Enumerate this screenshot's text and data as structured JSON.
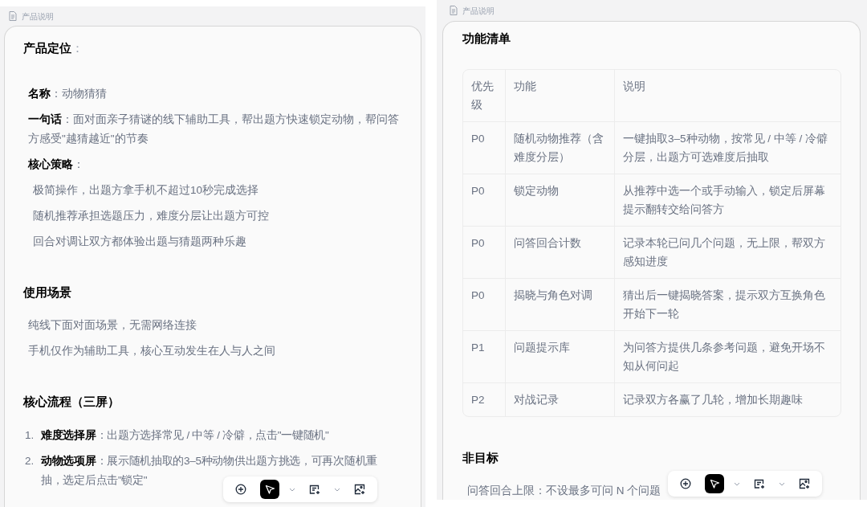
{
  "panels": [
    {
      "header": "产品说明",
      "blocks": [
        {
          "kind": "lead",
          "text": "**产品定位**："
        },
        {
          "kind": "field",
          "text": "**名称**：动物猜猜"
        },
        {
          "kind": "field",
          "text": "**一句话**：面对面亲子猜谜的线下辅助工具，帮出题方快速锁定动物，帮问答方感受\"越猜越近\"的节奏"
        },
        {
          "kind": "field",
          "text": "**核心策略**："
        },
        {
          "kind": "bullet",
          "text": "极简操作，出题方拿手机不超过10秒完成选择"
        },
        {
          "kind": "bullet",
          "text": "随机推荐承担选题压力，难度分层让出题方可控"
        },
        {
          "kind": "bullet",
          "text": "回合对调让双方都体验出题与猜题两种乐趣"
        },
        {
          "kind": "heading",
          "text": "使用场景"
        },
        {
          "kind": "plain",
          "text": "纯线下面对面场景，无需网络连接"
        },
        {
          "kind": "plain",
          "text": "手机仅作为辅助工具，核心互动发生在人与人之间"
        },
        {
          "kind": "heading",
          "text": "核心流程（三屏）"
        },
        {
          "kind": "numbered",
          "number": "1.",
          "text": "**难度选择屏**：出题方选择常见 / 中等 / 冷僻，点击\"一键随机\""
        },
        {
          "kind": "numbered",
          "number": "2.",
          "text": "**动物选项屏**：展示随机抽取的3–5种动物供出题方挑选，可再次随机重抽，选定后点击\"锁定\""
        }
      ],
      "toolbar": [
        {
          "kind": "add",
          "selected": false
        },
        {
          "kind": "pointer",
          "selected": true
        },
        {
          "kind": "caret",
          "selected": false
        },
        {
          "kind": "note",
          "selected": false
        },
        {
          "kind": "caret",
          "selected": false
        },
        {
          "kind": "image",
          "selected": false
        }
      ]
    },
    {
      "header": "产品说明",
      "blocks": [
        {
          "kind": "heading",
          "text": "功能清单"
        },
        {
          "kind": "table",
          "columns": [
            "优先级",
            "功能",
            "说明"
          ],
          "rows": [
            [
              "P0",
              "随机动物推荐（含难度分层）",
              "一键抽取3–5种动物，按常见 / 中等 / 冷僻分层，出题方可选难度后抽取"
            ],
            [
              "P0",
              "锁定动物",
              "从推荐中选一个或手动输入，锁定后屏幕提示翻转交给问答方"
            ],
            [
              "P0",
              "问答回合计数",
              "记录本轮已问几个问题，无上限，帮双方感知进度"
            ],
            [
              "P0",
              "揭晓与角色对调",
              "猜出后一键揭晓答案，提示双方互换角色开始下一轮"
            ],
            [
              "P1",
              "问题提示库",
              "为问答方提供几条参考问题，避免开场不知从何问起"
            ],
            [
              "P2",
              "对战记录",
              "记录双方各赢了几轮，增加长期趣味"
            ]
          ]
        },
        {
          "kind": "heading",
          "text": "非目标"
        },
        {
          "kind": "plain",
          "text": "问答回合上限：不设最多可问 N 个问题"
        }
      ],
      "toolbar": [
        {
          "kind": "add",
          "selected": false
        },
        {
          "kind": "pointer",
          "selected": true
        },
        {
          "kind": "caret",
          "selected": false
        },
        {
          "kind": "note",
          "selected": false
        },
        {
          "kind": "caret",
          "selected": false
        },
        {
          "kind": "image",
          "selected": false
        }
      ]
    }
  ]
}
